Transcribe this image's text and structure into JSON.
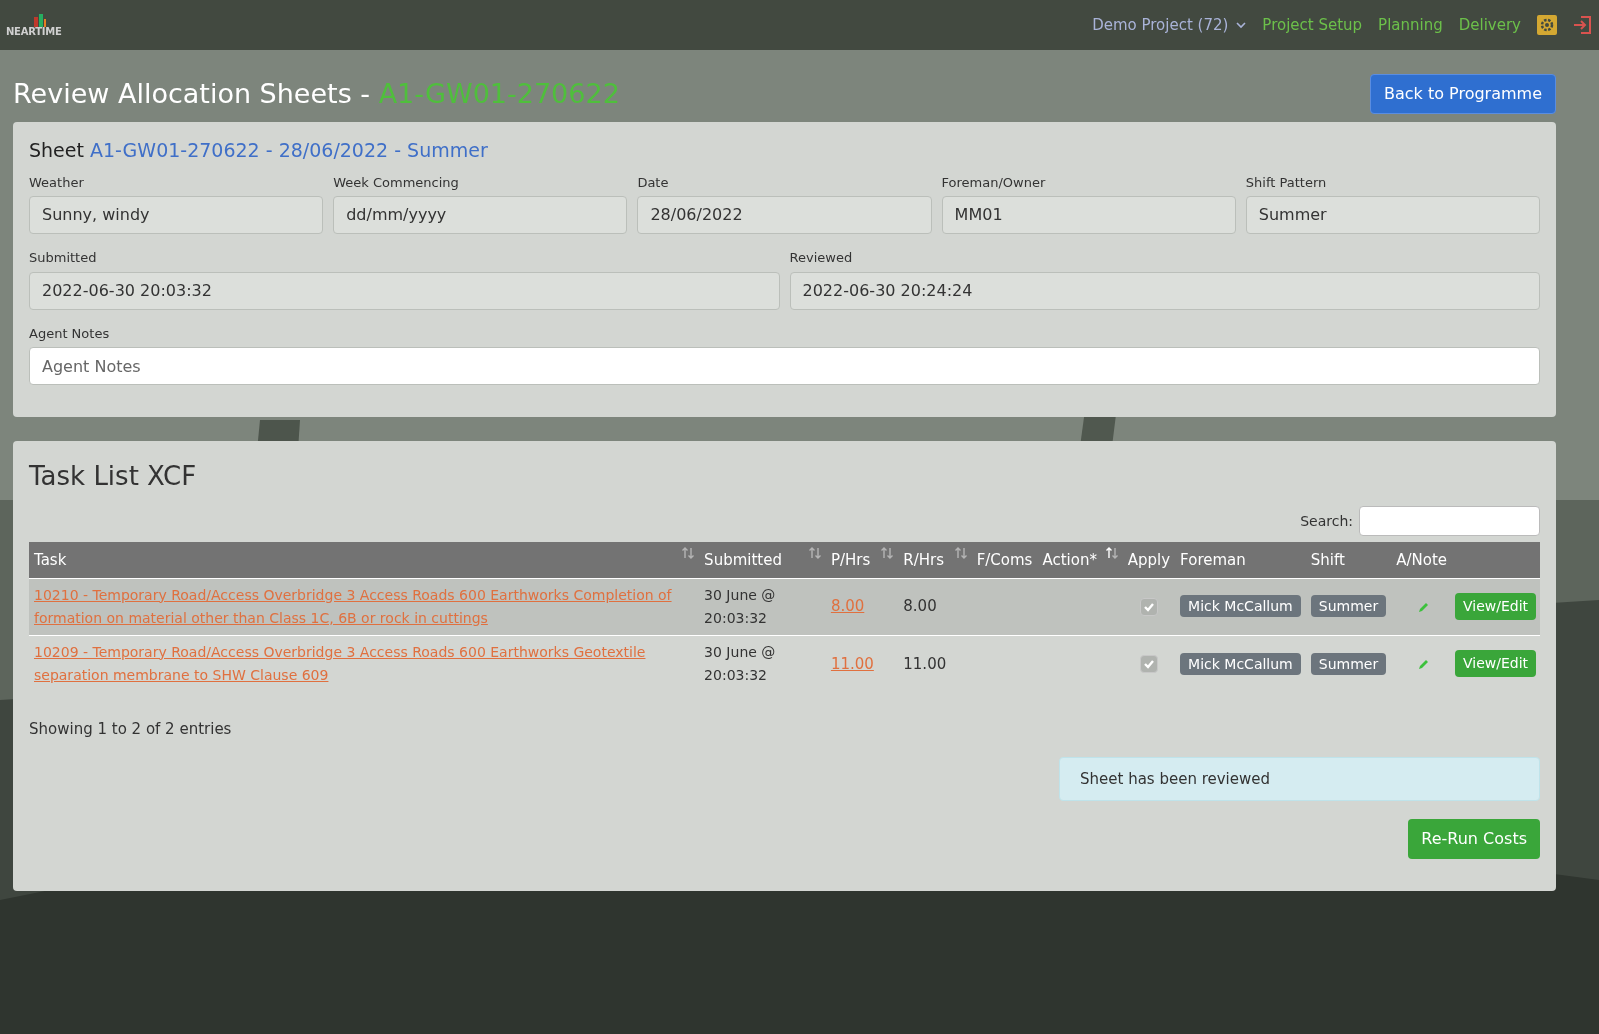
{
  "navbar": {
    "logo": "NEARTIME",
    "project": "Demo Project (72)",
    "links": [
      "Project Setup",
      "Planning",
      "Delivery"
    ]
  },
  "header": {
    "title": "Review Allocation Sheets - ",
    "sheet_code": "A1-GW01-270622",
    "back_button": "Back to Programme"
  },
  "sheet": {
    "label": "Sheet",
    "title": "A1-GW01-270622 - 28/06/2022 - Summer",
    "fields_row1": [
      {
        "label": "Weather",
        "value": "Sunny, windy"
      },
      {
        "label": "Week Commencing",
        "value": "dd/mm/yyyy"
      },
      {
        "label": "Date",
        "value": "28/06/2022"
      },
      {
        "label": "Foreman/Owner",
        "value": "MM01"
      },
      {
        "label": "Shift Pattern",
        "value": "Summer"
      }
    ],
    "fields_row2": [
      {
        "label": "Submitted",
        "value": "2022-06-30 20:03:32"
      },
      {
        "label": "Reviewed",
        "value": "2022-06-30 20:24:24"
      }
    ],
    "notes": {
      "label": "Agent Notes",
      "placeholder": "Agent Notes"
    }
  },
  "tasks": {
    "title": "Task List XCF",
    "search_label": "Search:",
    "columns": [
      {
        "label": "Task",
        "sortable": true,
        "sorted": false
      },
      {
        "label": "Submitted",
        "sortable": true,
        "sorted": false
      },
      {
        "label": "P/Hrs",
        "sortable": true,
        "sorted": false
      },
      {
        "label": "R/Hrs",
        "sortable": true,
        "sorted": false
      },
      {
        "label": "F/Coms",
        "sortable": false
      },
      {
        "label": "Action*",
        "sortable": true,
        "sorted": true
      },
      {
        "label": "Apply",
        "sortable": false
      },
      {
        "label": "Foreman",
        "sortable": false
      },
      {
        "label": "Shift",
        "sortable": false
      },
      {
        "label": "A/Note",
        "sortable": false
      }
    ],
    "rows": [
      {
        "task": "10210 - Temporary Road/Access Overbridge 3 Access Roads 600 Earthworks Completion of formation on material other than Class 1C, 6B or rock in cuttings",
        "submitted_date": "30 June @",
        "submitted_time": "20:03:32",
        "p_hrs": "8.00",
        "r_hrs": "8.00",
        "apply": true,
        "foreman": "Mick McCallum",
        "shift": "Summer",
        "action": "View/Edit"
      },
      {
        "task": "10209 - Temporary Road/Access Overbridge 3 Access Roads 600 Earthworks Geotextile separation membrane to SHW Clause 609",
        "submitted_date": "30 June @",
        "submitted_time": "20:03:32",
        "p_hrs": "11.00",
        "r_hrs": "11.00",
        "apply": true,
        "foreman": "Mick McCallum",
        "shift": "Summer",
        "action": "View/Edit"
      }
    ],
    "info": "Showing 1 to 2 of 2 entries",
    "alert": "Sheet has been reviewed",
    "rerun_button": "Re-Run Costs"
  }
}
